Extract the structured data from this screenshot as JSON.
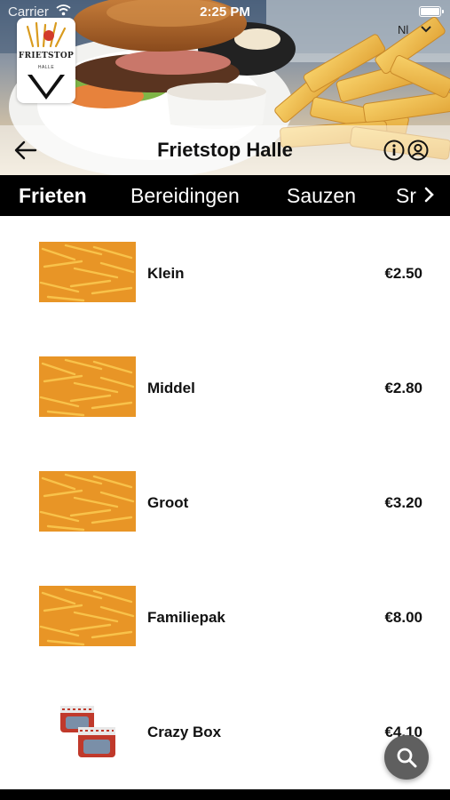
{
  "status_bar": {
    "carrier": "Carrier",
    "time": "2:25 PM"
  },
  "brand": {
    "logo_name": "FRIETSTOP",
    "logo_sub": "HALLE"
  },
  "language": {
    "current": "Nl"
  },
  "header": {
    "title": "Frietstop Halle",
    "back_icon": "arrow-left-icon",
    "info_icon": "info-circle-icon",
    "account_icon": "user-circle-icon"
  },
  "tabs": [
    {
      "label": "Frieten",
      "active": true
    },
    {
      "label": "Bereidingen",
      "active": false
    },
    {
      "label": "Sauzen",
      "active": false
    },
    {
      "label": "Sr",
      "active": false
    }
  ],
  "menu_items": [
    {
      "name": "Klein",
      "price": "€2.50",
      "image": "fries-image"
    },
    {
      "name": "Middel",
      "price": "€2.80",
      "image": "fries-image"
    },
    {
      "name": "Groot",
      "price": "€3.20",
      "image": "fries-image"
    },
    {
      "name": "Familiepak",
      "price": "€8.00",
      "image": "fries-image"
    },
    {
      "name": "Crazy Box",
      "price": "€4.10",
      "image": "box-image"
    }
  ],
  "search": {
    "icon": "search-icon"
  },
  "colors": {
    "tab_bar_bg": "#000000",
    "fab_bg": "#5f5f5f",
    "fries": "#f0a020"
  }
}
